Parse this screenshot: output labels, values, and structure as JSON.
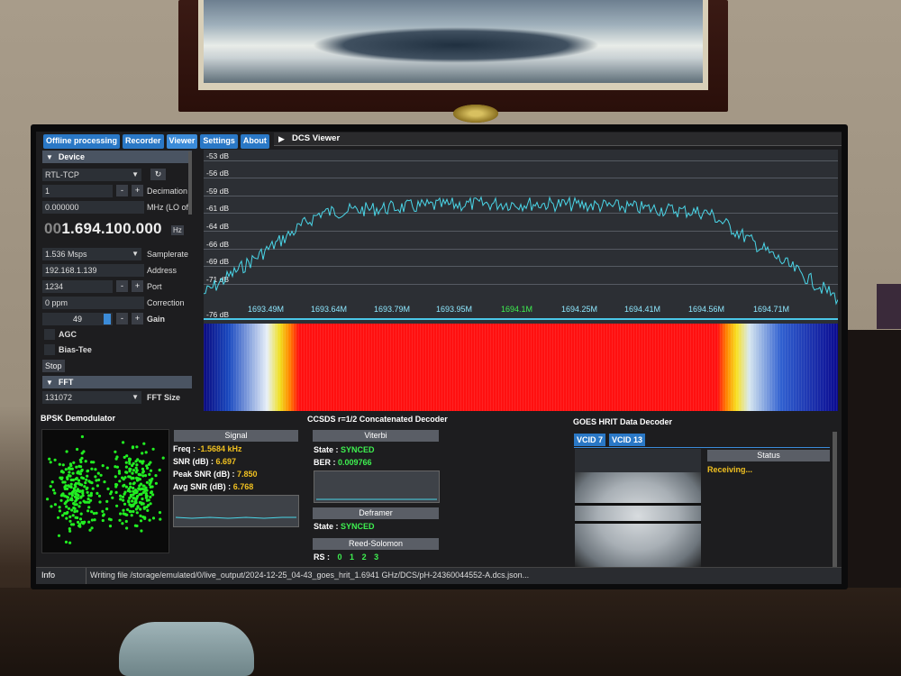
{
  "tabs": [
    "Offline processing",
    "Recorder",
    "Viewer",
    "Settings",
    "About"
  ],
  "viewer_title": "DCS Viewer",
  "device": {
    "header": "Device",
    "source": "RTL-TCP",
    "decimation_value": "1",
    "decimation_label": "Decimation",
    "lo_value": "0.000000",
    "lo_label": "MHz (LO of",
    "frequency_dim": "00",
    "frequency_main": "1.694.100.000",
    "frequency_unit": "Hz",
    "samplerate_value": "1.536 Msps",
    "samplerate_label": "Samplerate",
    "address_value": "192.168.1.139",
    "address_label": "Address",
    "port_value": "1234",
    "port_label": "Port",
    "correction_value": "0 ppm",
    "correction_label": "Correction",
    "gain_value": "49",
    "gain_label": "Gain",
    "agc_label": "AGC",
    "biastee_label": "Bias-Tee",
    "stop_label": "Stop"
  },
  "fft": {
    "header": "FFT",
    "size_value": "131072",
    "size_label": "FFT Size"
  },
  "spectrum": {
    "db_labels": [
      "-53 dB",
      "-56 dB",
      "-59 dB",
      "-61 dB",
      "-64 dB",
      "-66 dB",
      "-69 dB",
      "-71 dB",
      "-76 dB"
    ],
    "freq_labels": [
      "1693.49M",
      "1693.64M",
      "1693.79M",
      "1693.95M",
      "1694.1M",
      "1694.25M",
      "1694.41M",
      "1694.56M",
      "1694.71M"
    ],
    "center_freq_label": "1694.1M",
    "trace_color": "#4ad6e8"
  },
  "bpsk": {
    "title": "BPSK Demodulator",
    "signal_header": "Signal",
    "freq_label": "Freq :",
    "freq_value": "-1.5684 kHz",
    "snr_label": "SNR (dB) :",
    "snr_value": "6.697",
    "peak_snr_label": "Peak SNR (dB) :",
    "peak_snr_value": "7.850",
    "avg_snr_label": "Avg SNR (dB) :",
    "avg_snr_value": "6.768"
  },
  "ccsds": {
    "title": "CCSDS r=1/2 Concatenated Decoder",
    "viterbi_header": "Viterbi",
    "state_label": "State :",
    "viterbi_state": "SYNCED",
    "ber_label": "BER :",
    "ber_value": "0.009766",
    "deframer_header": "Deframer",
    "deframer_state_label": "State :",
    "deframer_state": "SYNCED",
    "rs_header": "Reed-Solomon",
    "rs_label": "RS :",
    "rs_values": [
      "0",
      "1",
      "2",
      "3"
    ]
  },
  "goes": {
    "title": "GOES HRIT Data Decoder",
    "vcid_tabs": [
      "VCID 7",
      "VCID 13"
    ],
    "status_header": "Status",
    "status_text": "Receiving..."
  },
  "statusbar": {
    "info_label": "Info",
    "message": "Writing file /storage/emulated/0/live_output/2024-12-25_04-43_goes_hrit_1.6941 GHz/DCS/pH-24360044552-A.dcs.json..."
  },
  "colors": {
    "accent": "#2a78c6",
    "synced": "#3ef050",
    "value": "#f0c020",
    "constellation": "#22ee22"
  }
}
